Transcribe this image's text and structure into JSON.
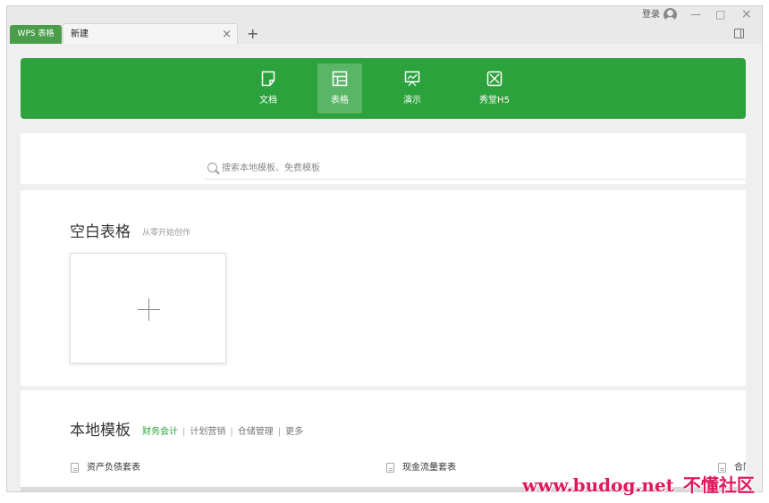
{
  "tabs": {
    "app_tab": "WPS 表格",
    "doc_tab": "新建",
    "close_glyph": "×",
    "new_tab_glyph": "+"
  },
  "window": {
    "login": "登录",
    "minimize": "—",
    "maximize": "□",
    "close": "×"
  },
  "nav": {
    "items": [
      {
        "label": "文档",
        "icon": "document-icon"
      },
      {
        "label": "表格",
        "icon": "table-icon",
        "active": true
      },
      {
        "label": "演示",
        "icon": "presentation-icon"
      },
      {
        "label": "秀堂H5",
        "icon": "image-icon"
      }
    ]
  },
  "search": {
    "placeholder": "搜索本地模板、免费模板"
  },
  "blank": {
    "title": "空白表格",
    "subtitle": "从零开始创作"
  },
  "local": {
    "title": "本地模板",
    "categories": [
      "财务会计",
      "计划营销",
      "仓储管理",
      "更多"
    ],
    "templates": [
      "资产负债套表",
      "现金流量套表",
      "合同"
    ]
  },
  "watermark": {
    "url": "www.budog.net",
    "text": "不懂社区"
  },
  "colors": {
    "accent": "#2ba23c",
    "app_tab": "#4a9e4a",
    "watermark": "#e0195a"
  }
}
